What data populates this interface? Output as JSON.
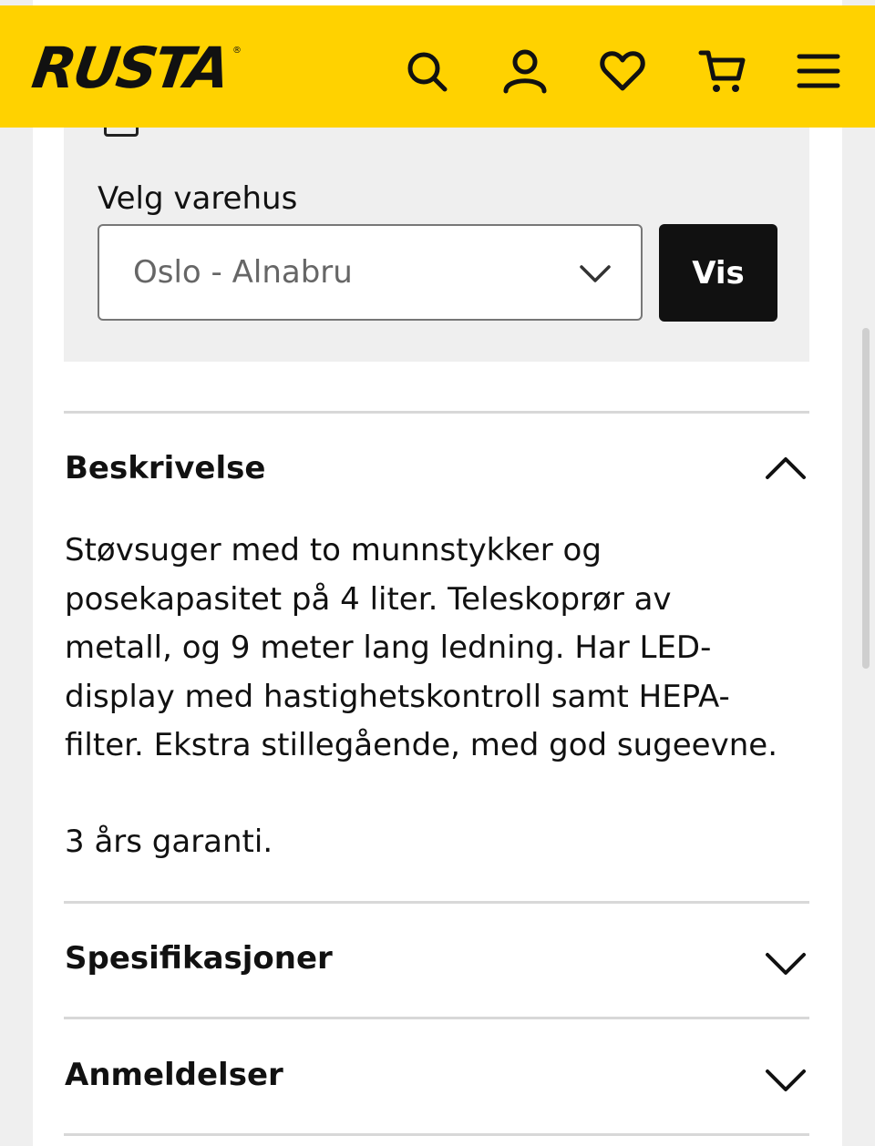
{
  "header": {
    "logo": "RUSTA",
    "logo_mark": "®",
    "icons": [
      "search-icon",
      "user-icon",
      "heart-icon",
      "cart-icon",
      "menu-icon"
    ],
    "background": "#ffd200"
  },
  "store": {
    "label": "Velg varehus",
    "selected": "Oslo - Alnabru",
    "button": "Vis"
  },
  "sections": {
    "description": {
      "title": "Beskrivelse",
      "lines": [
        "Støvsuger med to munnstykker og",
        "posekapasitet på 4 liter. Teleskoprør av",
        "metall, og 9 meter lang ledning. Har LED-",
        "display med hastighetskontroll samt HEPA-",
        "filter. Ekstra stillegående, med god sugeevne."
      ],
      "guarantee": "3 års garanti."
    },
    "specs": {
      "title": "Spesifikasjoner"
    },
    "reviews": {
      "title": "Anmeldelser"
    }
  }
}
